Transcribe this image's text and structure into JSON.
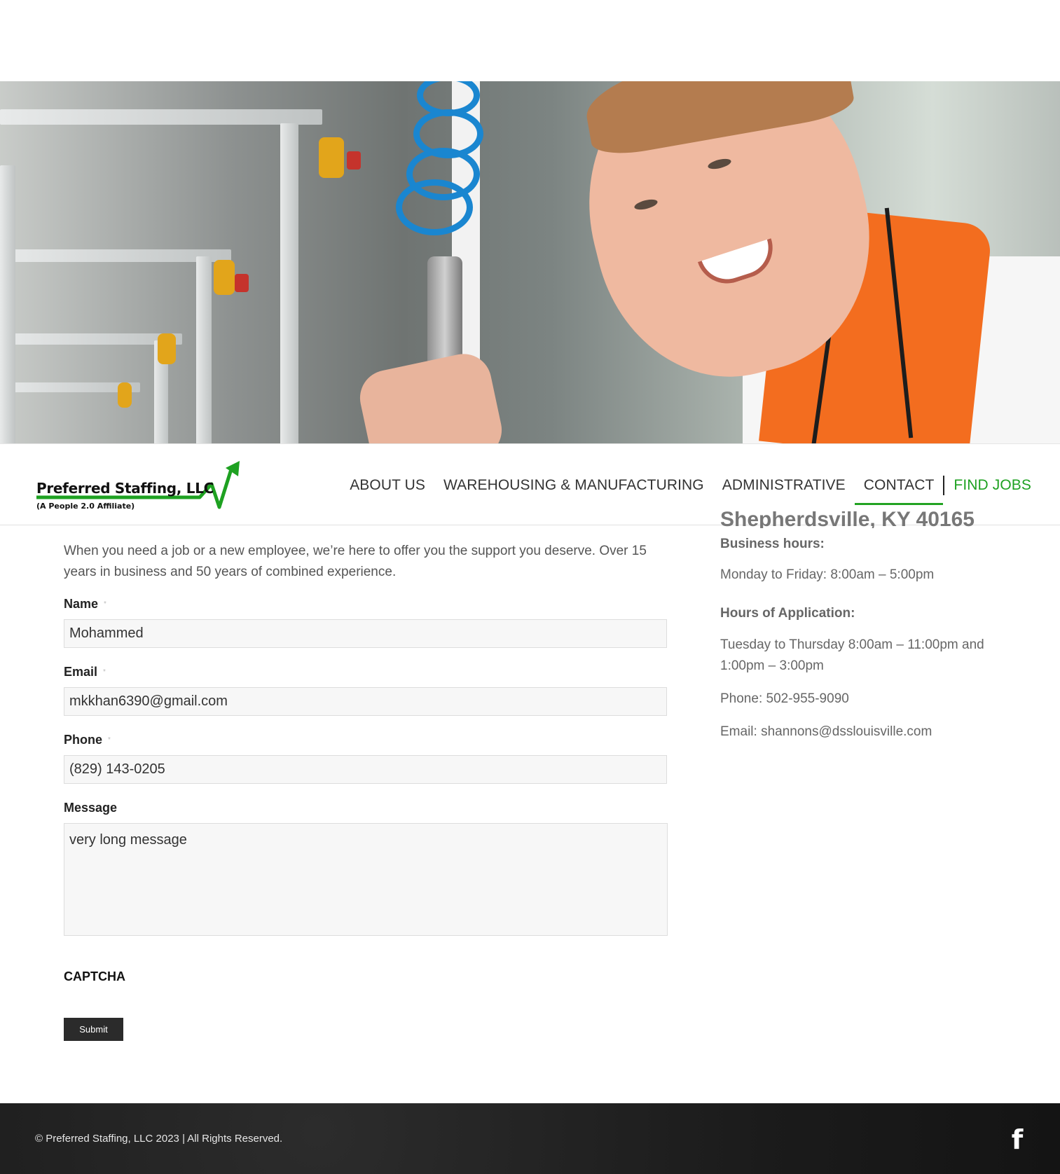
{
  "logo": {
    "name": "Preferred Staffing, LLC",
    "subtitle": "(A People 2.0 Affiliate)"
  },
  "nav": {
    "items": [
      {
        "label": "ABOUT US"
      },
      {
        "label": "WAREHOUSING & MANUFACTURING"
      },
      {
        "label": "ADMINISTRATIVE"
      },
      {
        "label": "CONTACT",
        "active": true
      },
      {
        "label": "FIND JOBS"
      }
    ]
  },
  "intro": "When you need a job or a new employee, we’re here to offer you the support you deserve. Over 15 years in business and 50 years of combined experience.",
  "form": {
    "name_label": "Name",
    "name_value": "Mohammed",
    "email_label": "Email",
    "email_value": "mkkhan6390@gmail.com",
    "phone_label": "Phone",
    "phone_value": "(829) 143-0205",
    "message_label": "Message",
    "message_value": "very long message",
    "required_marker": "*",
    "captcha_label": "CAPTCHA",
    "submit_label": "Submit"
  },
  "sidebar": {
    "address_cut": "Shepherdsville, KY 40165",
    "business_hours_heading": "Business hours:",
    "business_hours": "Monday to Friday: 8:00am – 5:00pm",
    "application_heading": "Hours of Application:",
    "application_hours": "Tuesday to Thursday 8:00am – 11:00pm and 1:00pm – 3:00pm",
    "phone": "Phone: 502-955-9090",
    "email": "Email: shannons@dsslouisville.com"
  },
  "footer": {
    "copyright": "© Preferred Staffing, LLC 2023 | All Rights Reserved.",
    "facebook_glyph": "f",
    "facebook_icon": "facebook-icon"
  },
  "colors": {
    "accent_green": "#1ea121",
    "submit_bg": "#2b2b2b",
    "footer_bg": "#1b1b1b",
    "vest_orange": "#f36d1f",
    "coil_blue": "#1a86d0"
  }
}
